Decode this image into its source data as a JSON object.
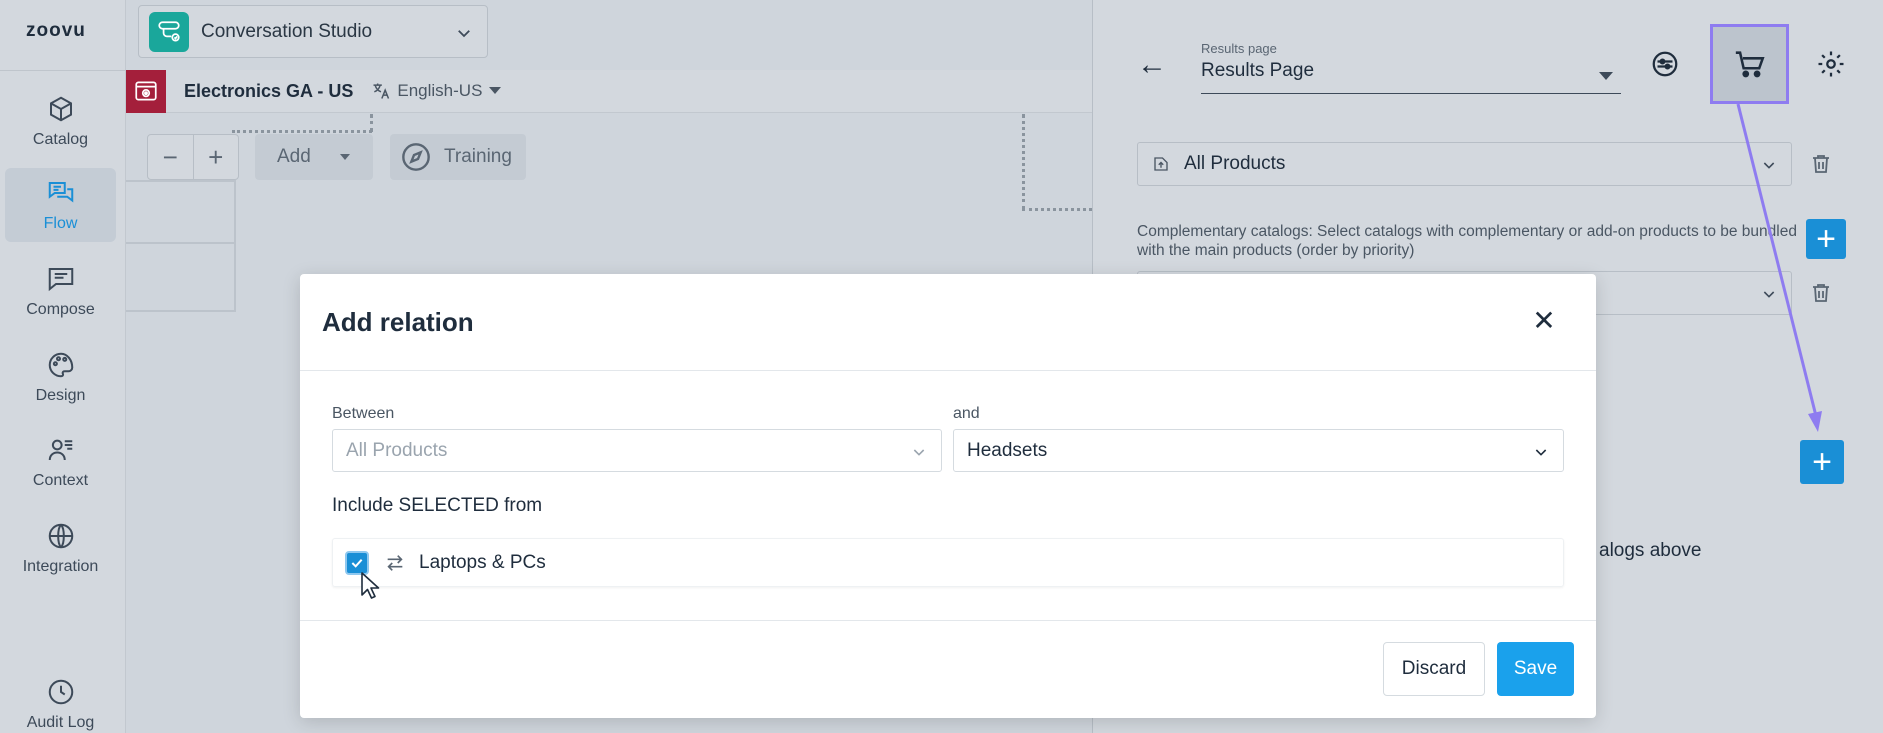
{
  "app": {
    "logo": "zoovu",
    "accent_color": "#1a8fd6",
    "highlight_color": "#8e7cf0"
  },
  "leftnav": {
    "items": [
      {
        "label": "Catalog",
        "icon": "cube-icon",
        "active": false
      },
      {
        "label": "Flow",
        "icon": "chat-bubbles-icon",
        "active": true
      },
      {
        "label": "Compose",
        "icon": "message-icon",
        "active": false
      },
      {
        "label": "Design",
        "icon": "palette-icon",
        "active": false
      },
      {
        "label": "Context",
        "icon": "user-list-icon",
        "active": false
      },
      {
        "label": "Integration",
        "icon": "globe-icon",
        "active": false
      },
      {
        "label": "Audit Log",
        "icon": "history-icon",
        "active": false
      }
    ]
  },
  "topbar": {
    "studio": "Conversation Studio",
    "site": "Electronics GA - US",
    "language": "English-US"
  },
  "canvas": {
    "zoom_out": "−",
    "zoom_in": "+",
    "add": "Add",
    "training": "Training"
  },
  "rightpanel": {
    "page_label": "Results page",
    "page_value": "Results Page",
    "catalog": "All Products",
    "complementary_text": "Complementary catalogs: Select catalogs with complementary or add-on products to be bundled with the main products (order by priority)",
    "partial_text": "alogs above"
  },
  "modal": {
    "title": "Add relation",
    "between_label": "Between",
    "between_value": "All Products",
    "and_label": "and",
    "and_value": "Headsets",
    "include_label": "Include SELECTED from",
    "option_label": "Laptops & PCs",
    "option_checked": true,
    "discard": "Discard",
    "save": "Save"
  }
}
